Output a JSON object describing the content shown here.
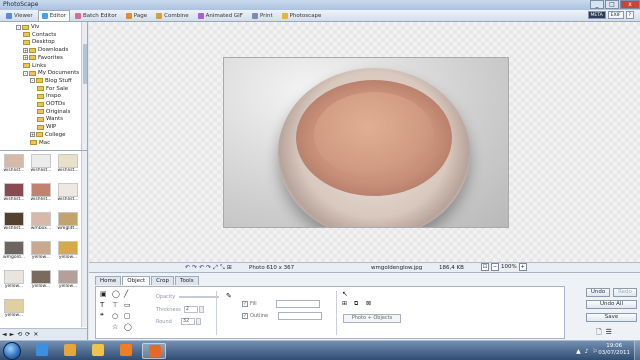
{
  "window": {
    "title": "PhotoScape",
    "controls": {
      "minimize": "_",
      "maximize": "□",
      "close": "x"
    }
  },
  "tabs": [
    {
      "label": "Viewer",
      "icon": "viewer-icon",
      "color": "#5b8ad6"
    },
    {
      "label": "Editor",
      "icon": "editor-icon",
      "color": "#4aa0d8"
    },
    {
      "label": "Batch Editor",
      "icon": "batch-editor-icon",
      "color": "#d96a9c"
    },
    {
      "label": "Page",
      "icon": "page-icon",
      "color": "#e18a3c"
    },
    {
      "label": "Combine",
      "icon": "combine-icon",
      "color": "#d4a03b"
    },
    {
      "label": "Animated GIF",
      "icon": "animated-gif-icon",
      "color": "#a85ed6"
    },
    {
      "label": "Print",
      "icon": "print-icon",
      "color": "#7a8ea8"
    },
    {
      "label": "Photoscape",
      "icon": "photoscape-icon",
      "color": "#e3b63a"
    }
  ],
  "active_tab": "Editor",
  "topright": {
    "meta": "META",
    "exif": "EXIF",
    "help": "?"
  },
  "tree": [
    {
      "label": "Viv",
      "level": 0,
      "expander": "-"
    },
    {
      "label": "Contacts",
      "level": 1,
      "expander": ""
    },
    {
      "label": "Desktop",
      "level": 1,
      "expander": ""
    },
    {
      "label": "Downloads",
      "level": 1,
      "expander": "+"
    },
    {
      "label": "Favorites",
      "level": 1,
      "expander": "+"
    },
    {
      "label": "Links",
      "level": 1,
      "expander": ""
    },
    {
      "label": "My Documents",
      "level": 1,
      "expander": "-"
    },
    {
      "label": "Blog Stuff",
      "level": 2,
      "expander": "-"
    },
    {
      "label": "For Sale",
      "level": 3,
      "expander": ""
    },
    {
      "label": "Inspo",
      "level": 3,
      "expander": ""
    },
    {
      "label": "OOTDs",
      "level": 3,
      "expander": ""
    },
    {
      "label": "Originals",
      "level": 3,
      "expander": ""
    },
    {
      "label": "Wants",
      "level": 3,
      "expander": ""
    },
    {
      "label": "WIP",
      "level": 3,
      "expander": ""
    },
    {
      "label": "College",
      "level": 2,
      "expander": "+"
    },
    {
      "label": "Mac",
      "level": 2,
      "expander": ""
    }
  ],
  "thumbnails": [
    {
      "caption": "wishlist...",
      "color": "#d6b9a8"
    },
    {
      "caption": "wishlist...",
      "color": "#ececec"
    },
    {
      "caption": "wishlist...",
      "color": "#e8e1c8"
    },
    {
      "caption": "wishlist...",
      "color": "#8a4a52"
    },
    {
      "caption": "wishlist...",
      "color": "#c1826f"
    },
    {
      "caption": "wishlist...",
      "color": "#efe7e2"
    },
    {
      "caption": "wishlist...",
      "color": "#54402f"
    },
    {
      "caption": "wmbox...",
      "color": "#d7b8aa"
    },
    {
      "caption": "wmglitt...",
      "color": "#c4a36a"
    },
    {
      "caption": "wmgold...",
      "color": "#6c6562"
    },
    {
      "caption": "yellow...",
      "color": "#c9a88e"
    },
    {
      "caption": "yellow...",
      "color": "#d8a94b"
    },
    {
      "caption": "yellow...",
      "color": "#e9e4e0"
    },
    {
      "caption": "yellow...",
      "color": "#7a6b5e"
    },
    {
      "caption": "yellow...",
      "color": "#b4a099"
    },
    {
      "caption": "yellow...",
      "color": "#e2cfa0"
    }
  ],
  "thumb_tools": [
    "◄",
    "►",
    "⟲",
    "⟳",
    "✕"
  ],
  "status": {
    "info": "Photo 610 x 367",
    "filename": "wmgoldenglow.jpg",
    "filesize": "186,4 KB",
    "zoom": "100%",
    "icons": [
      "↶",
      "↷",
      "↶",
      "↷",
      "⤢",
      "⤡",
      "⊞"
    ]
  },
  "panel": {
    "tabs": [
      "Home",
      "Object",
      "Crop",
      "Tools"
    ],
    "active_tab": "Object",
    "opacity_label": "Opacity",
    "thickness_label": "Thickness",
    "thickness_value": "2",
    "round_label": "Round",
    "round_value": "32",
    "fill_label": "Fill",
    "outline_label": "Outline",
    "photo_objects_label": "Photo + Objects"
  },
  "right_buttons": {
    "undo": "Undo",
    "redo": "Redo",
    "undo_all": "Undo All",
    "save": "Save"
  },
  "taskbar": {
    "apps": [
      {
        "name": "start-orb",
        "color": "#2b6eb8"
      },
      {
        "name": "internet-explorer-icon",
        "color": "#3d8fe0"
      },
      {
        "name": "photoscape-taskbar-icon",
        "color": "#e8a53a"
      },
      {
        "name": "windows-explorer-icon",
        "color": "#f0c44a"
      },
      {
        "name": "media-player-icon",
        "color": "#ef7d22"
      },
      {
        "name": "firefox-icon",
        "color": "#e06b2b"
      }
    ],
    "time": "19:06",
    "date": "03/07/2011",
    "tray": [
      "▲",
      "♪",
      "⚐"
    ]
  }
}
